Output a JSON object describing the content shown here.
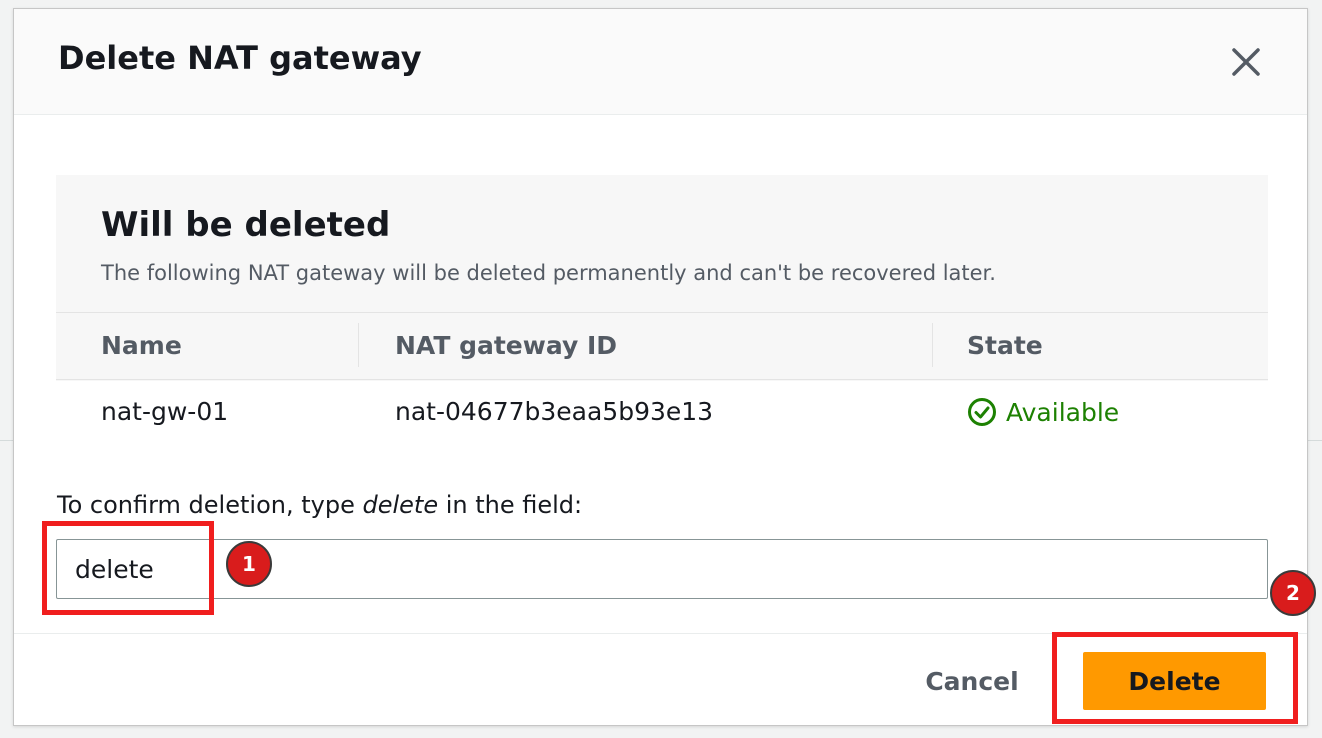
{
  "modal": {
    "title": "Delete NAT gateway",
    "close_icon": "close-icon"
  },
  "info": {
    "title": "Will be deleted",
    "description": "The following NAT gateway will be deleted permanently and can't be recovered later."
  },
  "table": {
    "columns": [
      "Name",
      "NAT gateway ID",
      "State"
    ],
    "rows": [
      {
        "name": "nat-gw-01",
        "id": "nat-04677b3eaa5b93e13",
        "state": "Available",
        "state_icon": "check-circle-icon",
        "state_color": "#1d8102"
      }
    ]
  },
  "confirm": {
    "label_prefix": "To confirm deletion, type ",
    "label_keyword": "delete",
    "label_suffix": " in the field:",
    "input_value": "delete"
  },
  "footer": {
    "cancel_label": "Cancel",
    "delete_label": "Delete",
    "delete_color": "#ff9900"
  },
  "annotations": {
    "step1": "1",
    "step2": "2",
    "highlight_color": "#f01e1e"
  }
}
